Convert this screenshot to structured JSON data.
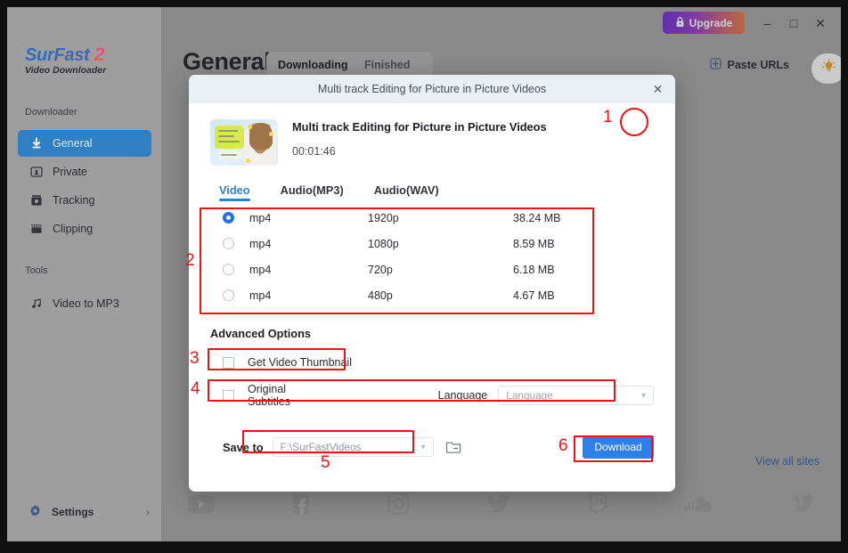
{
  "sidebar": {
    "brand": {
      "part1": "Sur",
      "part2": "Fast",
      "part3": "2",
      "subtitle": "Video Downloader"
    },
    "section_downloader": "Downloader",
    "section_tools": "Tools",
    "downloader_items": [
      {
        "label": "General",
        "icon": "download-arrow-icon",
        "active": true
      },
      {
        "label": "Private",
        "icon": "private-window-icon",
        "active": false
      },
      {
        "label": "Tracking",
        "icon": "tracking-camera-icon",
        "active": false
      },
      {
        "label": "Clipping",
        "icon": "clipping-film-icon",
        "active": false
      }
    ],
    "tools_items": [
      {
        "label": "Video to MP3",
        "icon": "music-note-icon",
        "active": false
      }
    ],
    "settings": {
      "label": "Settings",
      "icon": "gear-icon",
      "chevron": "›"
    }
  },
  "titlebar": {
    "upgrade_label": "Upgrade",
    "upgrade_icon": "lock-icon",
    "minimize": "–",
    "maximize": "□",
    "close": "✕"
  },
  "header": {
    "page_title": "General",
    "tabs": [
      {
        "label": "Downloading",
        "selected": true
      },
      {
        "label": "Finished",
        "selected": false
      }
    ],
    "paste_urls_label": "Paste URLs",
    "paste_urls_icon": "plus-box-icon",
    "tips_icon": "lightbulb-icon"
  },
  "background": {
    "view_all_sites": "View all sites",
    "social_icons": [
      "youtube-icon",
      "facebook-icon",
      "instagram-icon",
      "twitter-icon",
      "twitch-icon",
      "soundcloud-icon",
      "vimeo-icon"
    ]
  },
  "dialog": {
    "header_title": "Multi track Editing for Picture in Picture Videos",
    "close_icon": "close-icon",
    "video": {
      "title": "Multi track Editing for Picture in Picture Videos",
      "duration": "00:01:46",
      "edit_icon": "pencil-edit-icon",
      "thumbnail": "video-thumbnail"
    },
    "format_tabs": [
      {
        "label": "Video",
        "active": true
      },
      {
        "label": "Audio(MP3)",
        "active": false
      },
      {
        "label": "Audio(WAV)",
        "active": false
      }
    ],
    "quality_rows": [
      {
        "format": "mp4",
        "resolution": "1920p",
        "size": "38.24 MB",
        "selected": true
      },
      {
        "format": "mp4",
        "resolution": "1080p",
        "size": "8.59 MB",
        "selected": false
      },
      {
        "format": "mp4",
        "resolution": "720p",
        "size": "6.18 MB",
        "selected": false
      },
      {
        "format": "mp4",
        "resolution": "480p",
        "size": "4.67 MB",
        "selected": false
      }
    ],
    "advanced_title": "Advanced Options",
    "thumbnail_checkbox": {
      "label": "Get Video Thumbnail",
      "checked": false
    },
    "subtitles_checkbox": {
      "label": "Original Subtitles",
      "checked": false
    },
    "language_label": "Language",
    "language_select": {
      "value": "Language",
      "chevron": "⌄"
    },
    "save_to_label": "Save to",
    "path_select": {
      "value": "F:\\SurFastVideos",
      "chevron": "⌄"
    },
    "folder_icon": "folder-open-icon",
    "download_label": "Download"
  },
  "annotations": {
    "n1": "1",
    "n2": "2",
    "n3": "3",
    "n4": "4",
    "n5": "5",
    "n6": "6",
    "color": "#ee1111"
  }
}
